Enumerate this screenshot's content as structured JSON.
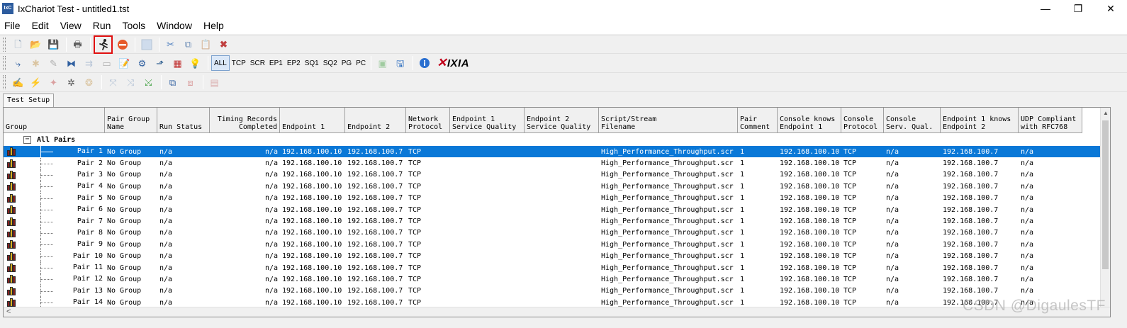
{
  "window": {
    "title": "IxChariot Test - untitled1.tst",
    "icon_text": "IxC",
    "minimize": "—",
    "maximize": "❐",
    "close": "✕"
  },
  "menu": [
    "File",
    "Edit",
    "View",
    "Run",
    "Tools",
    "Window",
    "Help"
  ],
  "toolbar1": [
    {
      "name": "new-file-icon",
      "glyph": "🗋",
      "color": "#8aa0b8"
    },
    {
      "name": "open-folder-icon",
      "glyph": "📂",
      "color": "#d9a520"
    },
    {
      "name": "save-icon",
      "glyph": "💾",
      "color": "#3a6aa8"
    },
    {
      "name": "print-icon",
      "glyph": "🖶",
      "color": "#606060"
    },
    {
      "name": "run-icon",
      "glyph": "🏃",
      "color": "#303030"
    },
    {
      "name": "stop-icon",
      "glyph": "⬣",
      "color": "#e05020"
    },
    {
      "name": "abort-icon",
      "glyph": "⊘",
      "color": "#8fb0d8"
    },
    {
      "name": "cut-icon",
      "glyph": "✂",
      "color": "#5080c0"
    },
    {
      "name": "copy-icon",
      "glyph": "⧉",
      "color": "#7090b8"
    },
    {
      "name": "paste-icon",
      "glyph": "📋",
      "color": "#c09040"
    },
    {
      "name": "delete-icon",
      "glyph": "✖",
      "color": "#c04040"
    }
  ],
  "toolbar2": {
    "icons_left": [
      "add-pair-icon",
      "add-multicast-icon",
      "edit-icon",
      "add-group-icon",
      "delete-pair-icon",
      "duplicate-icon",
      "edit-script-icon",
      "set-hardware-icon",
      "run-options-icon",
      "renumber-icon",
      "help-icon-2"
    ],
    "filters": [
      "ALL",
      "TCP",
      "SCR",
      "EP1",
      "EP2",
      "SQ1",
      "SQ2",
      "PG",
      "PC"
    ],
    "active_filter": "ALL",
    "logo": "IXIA"
  },
  "tabs": [
    "Test Setup"
  ],
  "grid": {
    "columns": [
      {
        "label": "Group",
        "width": 143,
        "align": "left"
      },
      {
        "label": "Pair Group\nName",
        "width": 74,
        "align": "left"
      },
      {
        "label": "Run Status",
        "width": 74,
        "align": "left"
      },
      {
        "label": "Timing Records\nCompleted",
        "width": 99,
        "align": "right"
      },
      {
        "label": "Endpoint 1",
        "width": 92,
        "align": "left"
      },
      {
        "label": "Endpoint 2",
        "width": 86,
        "align": "left"
      },
      {
        "label": "Network\nProtocol",
        "width": 62,
        "align": "left"
      },
      {
        "label": "Endpoint 1\nService Quality",
        "width": 105,
        "align": "left"
      },
      {
        "label": "Endpoint 2\nService Quality",
        "width": 105,
        "align": "left"
      },
      {
        "label": "Script/Stream\nFilename",
        "width": 196,
        "align": "left"
      },
      {
        "label": "Pair\nComment",
        "width": 56,
        "align": "left"
      },
      {
        "label": "Console knows\nEndpoint 1",
        "width": 90,
        "align": "left"
      },
      {
        "label": "Console\nProtocol",
        "width": 60,
        "align": "left"
      },
      {
        "label": "Console\nServ. Qual.",
        "width": 80,
        "align": "left"
      },
      {
        "label": "Endpoint 1 knows\nEndpoint 2",
        "width": 110,
        "align": "left"
      },
      {
        "label": "UDP Compliant\nwith RFC768",
        "width": 90,
        "align": "left"
      }
    ],
    "group_label": "All Pairs",
    "expander": "−",
    "rows": [
      {
        "pair": "Pair 1",
        "group_name": "No Group",
        "run_status": "n/a",
        "timing": "n/a",
        "ep1": "192.168.100.10",
        "ep2": "192.168.100.7",
        "proto": "TCP",
        "ep1_sq": "",
        "ep2_sq": "",
        "script": "High_Performance_Throughput.scr",
        "comment": "1",
        "console_ep1": "192.168.100.10",
        "console_proto": "TCP",
        "console_sq": "n/a",
        "ep1_knows_ep2": "192.168.100.7",
        "udp": "n/a"
      },
      {
        "pair": "Pair 2",
        "group_name": "No Group",
        "run_status": "n/a",
        "timing": "n/a",
        "ep1": "192.168.100.10",
        "ep2": "192.168.100.7",
        "proto": "TCP",
        "ep1_sq": "",
        "ep2_sq": "",
        "script": "High_Performance_Throughput.scr",
        "comment": "1",
        "console_ep1": "192.168.100.10",
        "console_proto": "TCP",
        "console_sq": "n/a",
        "ep1_knows_ep2": "192.168.100.7",
        "udp": "n/a"
      },
      {
        "pair": "Pair 3",
        "group_name": "No Group",
        "run_status": "n/a",
        "timing": "n/a",
        "ep1": "192.168.100.10",
        "ep2": "192.168.100.7",
        "proto": "TCP",
        "ep1_sq": "",
        "ep2_sq": "",
        "script": "High_Performance_Throughput.scr",
        "comment": "1",
        "console_ep1": "192.168.100.10",
        "console_proto": "TCP",
        "console_sq": "n/a",
        "ep1_knows_ep2": "192.168.100.7",
        "udp": "n/a"
      },
      {
        "pair": "Pair 4",
        "group_name": "No Group",
        "run_status": "n/a",
        "timing": "n/a",
        "ep1": "192.168.100.10",
        "ep2": "192.168.100.7",
        "proto": "TCP",
        "ep1_sq": "",
        "ep2_sq": "",
        "script": "High_Performance_Throughput.scr",
        "comment": "1",
        "console_ep1": "192.168.100.10",
        "console_proto": "TCP",
        "console_sq": "n/a",
        "ep1_knows_ep2": "192.168.100.7",
        "udp": "n/a"
      },
      {
        "pair": "Pair 5",
        "group_name": "No Group",
        "run_status": "n/a",
        "timing": "n/a",
        "ep1": "192.168.100.10",
        "ep2": "192.168.100.7",
        "proto": "TCP",
        "ep1_sq": "",
        "ep2_sq": "",
        "script": "High_Performance_Throughput.scr",
        "comment": "1",
        "console_ep1": "192.168.100.10",
        "console_proto": "TCP",
        "console_sq": "n/a",
        "ep1_knows_ep2": "192.168.100.7",
        "udp": "n/a"
      },
      {
        "pair": "Pair 6",
        "group_name": "No Group",
        "run_status": "n/a",
        "timing": "n/a",
        "ep1": "192.168.100.10",
        "ep2": "192.168.100.7",
        "proto": "TCP",
        "ep1_sq": "",
        "ep2_sq": "",
        "script": "High_Performance_Throughput.scr",
        "comment": "1",
        "console_ep1": "192.168.100.10",
        "console_proto": "TCP",
        "console_sq": "n/a",
        "ep1_knows_ep2": "192.168.100.7",
        "udp": "n/a"
      },
      {
        "pair": "Pair 7",
        "group_name": "No Group",
        "run_status": "n/a",
        "timing": "n/a",
        "ep1": "192.168.100.10",
        "ep2": "192.168.100.7",
        "proto": "TCP",
        "ep1_sq": "",
        "ep2_sq": "",
        "script": "High_Performance_Throughput.scr",
        "comment": "1",
        "console_ep1": "192.168.100.10",
        "console_proto": "TCP",
        "console_sq": "n/a",
        "ep1_knows_ep2": "192.168.100.7",
        "udp": "n/a"
      },
      {
        "pair": "Pair 8",
        "group_name": "No Group",
        "run_status": "n/a",
        "timing": "n/a",
        "ep1": "192.168.100.10",
        "ep2": "192.168.100.7",
        "proto": "TCP",
        "ep1_sq": "",
        "ep2_sq": "",
        "script": "High_Performance_Throughput.scr",
        "comment": "1",
        "console_ep1": "192.168.100.10",
        "console_proto": "TCP",
        "console_sq": "n/a",
        "ep1_knows_ep2": "192.168.100.7",
        "udp": "n/a"
      },
      {
        "pair": "Pair 9",
        "group_name": "No Group",
        "run_status": "n/a",
        "timing": "n/a",
        "ep1": "192.168.100.10",
        "ep2": "192.168.100.7",
        "proto": "TCP",
        "ep1_sq": "",
        "ep2_sq": "",
        "script": "High_Performance_Throughput.scr",
        "comment": "1",
        "console_ep1": "192.168.100.10",
        "console_proto": "TCP",
        "console_sq": "n/a",
        "ep1_knows_ep2": "192.168.100.7",
        "udp": "n/a"
      },
      {
        "pair": "Pair 10",
        "group_name": "No Group",
        "run_status": "n/a",
        "timing": "n/a",
        "ep1": "192.168.100.10",
        "ep2": "192.168.100.7",
        "proto": "TCP",
        "ep1_sq": "",
        "ep2_sq": "",
        "script": "High_Performance_Throughput.scr",
        "comment": "1",
        "console_ep1": "192.168.100.10",
        "console_proto": "TCP",
        "console_sq": "n/a",
        "ep1_knows_ep2": "192.168.100.7",
        "udp": "n/a"
      },
      {
        "pair": "Pair 11",
        "group_name": "No Group",
        "run_status": "n/a",
        "timing": "n/a",
        "ep1": "192.168.100.10",
        "ep2": "192.168.100.7",
        "proto": "TCP",
        "ep1_sq": "",
        "ep2_sq": "",
        "script": "High_Performance_Throughput.scr",
        "comment": "1",
        "console_ep1": "192.168.100.10",
        "console_proto": "TCP",
        "console_sq": "n/a",
        "ep1_knows_ep2": "192.168.100.7",
        "udp": "n/a"
      },
      {
        "pair": "Pair 12",
        "group_name": "No Group",
        "run_status": "n/a",
        "timing": "n/a",
        "ep1": "192.168.100.10",
        "ep2": "192.168.100.7",
        "proto": "TCP",
        "ep1_sq": "",
        "ep2_sq": "",
        "script": "High_Performance_Throughput.scr",
        "comment": "1",
        "console_ep1": "192.168.100.10",
        "console_proto": "TCP",
        "console_sq": "n/a",
        "ep1_knows_ep2": "192.168.100.7",
        "udp": "n/a"
      },
      {
        "pair": "Pair 13",
        "group_name": "No Group",
        "run_status": "n/a",
        "timing": "n/a",
        "ep1": "192.168.100.10",
        "ep2": "192.168.100.7",
        "proto": "TCP",
        "ep1_sq": "",
        "ep2_sq": "",
        "script": "High_Performance_Throughput.scr",
        "comment": "1",
        "console_ep1": "192.168.100.10",
        "console_proto": "TCP",
        "console_sq": "n/a",
        "ep1_knows_ep2": "192.168.100.7",
        "udp": "n/a"
      },
      {
        "pair": "Pair 14",
        "group_name": "No Group",
        "run_status": "n/a",
        "timing": "n/a",
        "ep1": "192.168.100.10",
        "ep2": "192.168.100.7",
        "proto": "TCP",
        "ep1_sq": "",
        "ep2_sq": "",
        "script": "High_Performance_Throughput.scr",
        "comment": "1",
        "console_ep1": "192.168.100.10",
        "console_proto": "TCP",
        "console_sq": "n/a",
        "ep1_knows_ep2": "192.168.100.7",
        "udp": "n/a"
      }
    ],
    "selected_row": 0
  },
  "watermark": "CSDN @DigaulesTF",
  "colors": {
    "selection": "#0a78d7",
    "run_highlight": "#e01010",
    "ixia_red": "#c0001a"
  }
}
